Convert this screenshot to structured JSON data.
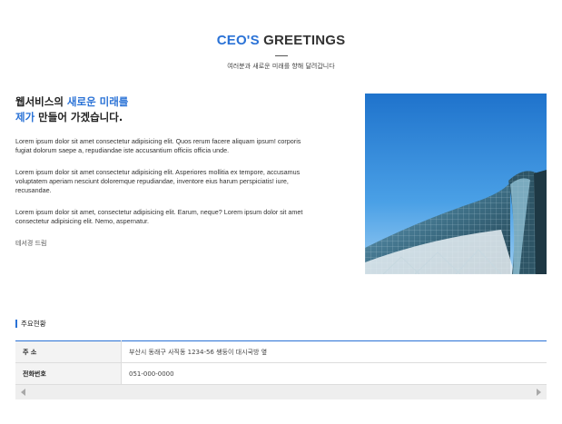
{
  "header": {
    "title_accent": "CEO'S",
    "title_rest": " GREETINGS",
    "subtitle": "여러분과 새로운 미래를 향해 달려갑니다"
  },
  "intro": {
    "headline_line1_plain": "웹서비스의 ",
    "headline_line1_blue": "새로운 미래를",
    "headline_line2_blue": "제가",
    "headline_line2_plain": " 만들어 가겠습니다.",
    "paragraphs": [
      "Lorem ipsum dolor sit amet consectetur adipisicing elit. Quos rerum facere aliquam ipsum! corporis fugiat dolorum saepe a, repudiandae iste accusantium officiis officia unde.",
      "Lorem ipsum dolor sit amet consectetur adipisicing elit. Asperiores mollitia ex tempore, accusamus voluptatem aperiam nesciunt doloremque repudiandae, inventore eius harum perspiciatis! iure, recusandae.",
      "Lorem ipsum dolor sit amet, consectetur adipisicing elit. Earum, neque? Lorem ipsum dolor sit amet consectetur adipisicing elit. Nemo, aspernatur."
    ],
    "signature": "테서경 드림"
  },
  "photo": {
    "icon": "building-photo"
  },
  "status": {
    "title": "주요현황",
    "rows": [
      {
        "label": "주 소",
        "value": "부산시 동래구 사직동 1234-56 쌩둥이 대시국방 옆"
      },
      {
        "label": "전화번호",
        "value": "051-000-0000"
      }
    ]
  },
  "colors": {
    "accent": "#2a72d6",
    "sky": "#2f86d6"
  }
}
